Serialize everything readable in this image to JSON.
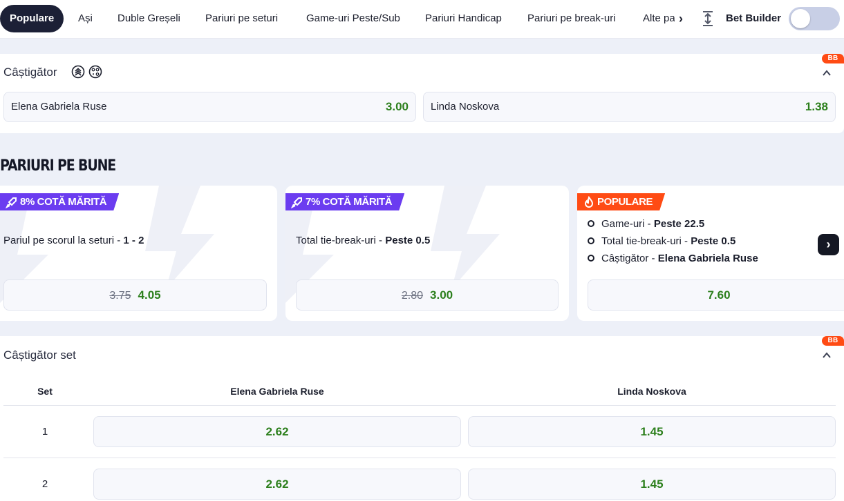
{
  "tabs": [
    {
      "label": "Populare",
      "active": true
    },
    {
      "label": "Ași"
    },
    {
      "label": "Duble Greșeli"
    },
    {
      "label": "Pariuri pe seturi"
    },
    {
      "label": "Game-uri Peste/Sub"
    },
    {
      "label": "Pariuri Handicap"
    },
    {
      "label": "Pariuri pe break-uri"
    },
    {
      "label": "Alte pariuri"
    }
  ],
  "bet_builder": {
    "label": "Bet Builder",
    "enabled": false
  },
  "badge": "BB",
  "winner": {
    "title": "Câștigător",
    "options": [
      {
        "name": "Elena Gabriela Ruse",
        "odds": "3.00"
      },
      {
        "name": "Linda Noskova",
        "odds": "1.38"
      }
    ]
  },
  "boosts": {
    "heading": "PARIURI PE BUNE",
    "cards": [
      {
        "tag": "8% COTĂ MĂRITĂ",
        "market": "Pariul pe scorul la seturi",
        "selection": "1 - 2",
        "old_odds": "3.75",
        "new_odds": "4.05"
      },
      {
        "tag": "7% COTĂ MĂRITĂ",
        "market": "Total tie-break-uri",
        "selection": "Peste 0.5",
        "old_odds": "2.80",
        "new_odds": "3.00"
      },
      {
        "tag": "POPULARE",
        "legs": [
          {
            "market": "Game-uri",
            "selection": "Peste 22.5"
          },
          {
            "market": "Total tie-break-uri",
            "selection": "Peste 0.5"
          },
          {
            "market": "Câștigător",
            "selection": "Elena Gabriela Ruse"
          }
        ],
        "odds": "7.60"
      }
    ],
    "colors": {
      "boost_tag": "#6b3cf0",
      "popular_tag": "#ff4b14",
      "odds_green": "#2c7f1c"
    }
  },
  "set_winner": {
    "title": "Câștigător set",
    "columns": [
      "Set",
      "Elena Gabriela Ruse",
      "Linda Noskova"
    ],
    "rows": [
      {
        "set": "1",
        "odds": [
          "2.62",
          "1.45"
        ]
      },
      {
        "set": "2",
        "odds": [
          "2.62",
          "1.45"
        ]
      }
    ]
  }
}
